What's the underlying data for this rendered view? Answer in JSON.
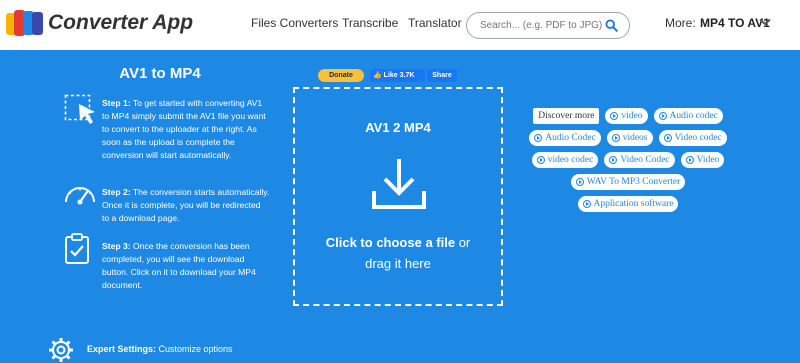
{
  "header": {
    "brand": "Converter App",
    "nav": [
      "Files Converters",
      "Transcribe",
      "Translator"
    ],
    "search_placeholder": "Search... (e.g. PDF to JPG)",
    "more_label": "More:",
    "more_value": "MP4 TO AV1"
  },
  "left": {
    "title": "AV1 to MP4",
    "steps": [
      {
        "head": "Step 1:",
        "body": " To get started with converting AV1 to MP4 simply submit the AV1 file you want to convert to the uploader at the right. As soon as the upload is complete the conversion will start automatically."
      },
      {
        "head": "Step 2:",
        "body": " The conversion starts automatically. Once it is complete, you will be redirected to a download page."
      },
      {
        "head": "Step 3:",
        "body": " Once the conversion has been completed, you will see the download button. Click on it to download your MP4 document."
      }
    ],
    "expert_head": "Expert Settings:",
    "expert_body": " Customize options"
  },
  "social": {
    "donate": "Donate",
    "like": "Like 3.7K",
    "share": "Share"
  },
  "dropzone": {
    "title": "AV1 2 MP4",
    "click_bold": "Click to choose a file",
    "click_rest": " or",
    "line2": "drag it here"
  },
  "tags": {
    "discover": "Discover more",
    "items": [
      "video",
      "Audio codec",
      "Audio Codec",
      "videos",
      "Video codec",
      "video codec",
      "Video Codec",
      "Video",
      "WAV To MP3 Converter",
      "Application software"
    ]
  },
  "colors": {
    "background": "#1e88e5",
    "header": "#ffffff",
    "donate": "#f8c13a",
    "facebook": "#1877f2"
  }
}
